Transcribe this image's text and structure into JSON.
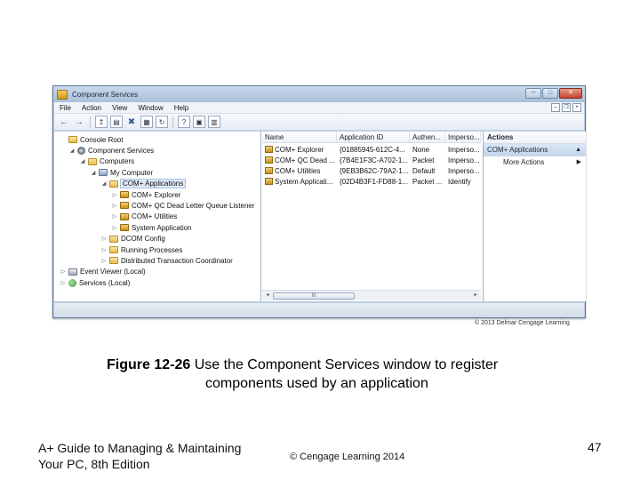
{
  "window": {
    "title": "Component Services",
    "controls": {
      "minimize": "─",
      "maximize": "□",
      "close": "✕"
    }
  },
  "menubar": {
    "items": [
      "File",
      "Action",
      "View",
      "Window",
      "Help"
    ],
    "mdi_controls": {
      "minimize": "–",
      "restore": "❐",
      "close": "×"
    }
  },
  "toolbar": {
    "back_icon": "←",
    "forward_icon": "→",
    "up_icon": "↥",
    "show_tree_icon": "▤",
    "delete_icon": "✖",
    "properties_icon": "▦",
    "refresh_icon": "↻",
    "help_icon": "?",
    "view_icon": "▣",
    "detail_icon": "▥"
  },
  "tree": {
    "items": [
      {
        "label": "Console Root",
        "toggle": "",
        "icon": "folder"
      },
      {
        "label": "Component Services",
        "toggle": "◢",
        "icon": "gear"
      },
      {
        "label": "Computers",
        "toggle": "◢",
        "icon": "folder"
      },
      {
        "label": "My Computer",
        "toggle": "◢",
        "icon": "computer"
      },
      {
        "label": "COM+ Applications",
        "toggle": "◢",
        "icon": "folder"
      },
      {
        "label": "COM+ Explorer",
        "toggle": "▷",
        "icon": "box"
      },
      {
        "label": "COM+ QC Dead Letter Queue Listener",
        "toggle": "▷",
        "icon": "box"
      },
      {
        "label": "COM+ Utilities",
        "toggle": "▷",
        "icon": "box"
      },
      {
        "label": "System Application",
        "toggle": "▷",
        "icon": "box"
      },
      {
        "label": "DCOM Config",
        "toggle": "▷",
        "icon": "folder"
      },
      {
        "label": "Running Processes",
        "toggle": "▷",
        "icon": "folder"
      },
      {
        "label": "Distributed Transaction Coordinator",
        "toggle": "▷",
        "icon": "folder"
      },
      {
        "label": "Event Viewer (Local)",
        "toggle": "▷",
        "icon": "viewer"
      },
      {
        "label": "Services (Local)",
        "toggle": "▷",
        "icon": "globe"
      }
    ]
  },
  "list": {
    "columns": [
      "Name",
      "Application ID",
      "Authen...",
      "Imperso..."
    ],
    "rows": [
      [
        "COM+ Explorer",
        "{01885945-612C-4...",
        "None",
        "Imperso..."
      ],
      [
        "COM+ QC Dead ...",
        "{7B4E1F3C-A702-1...",
        "Packet",
        "Imperso..."
      ],
      [
        "COM+ Utilities",
        "{9EB3B62C-79A2-1...",
        "Default",
        "Imperso..."
      ],
      [
        "System Applicati...",
        "{02D4B3F1-FD88-1...",
        "Packet ...",
        "Identify"
      ]
    ],
    "scroll": {
      "left": "◂",
      "right": "▸",
      "grip": "III"
    }
  },
  "actions": {
    "header": "Actions",
    "section": "COM+ Applications",
    "section_caret": "▲",
    "more": "More Actions",
    "more_caret": "▶"
  },
  "credit": "© 2013 Delmar Cengage Learning",
  "caption": {
    "label": "Figure 12-26",
    "line1": " Use the Component Services window to register",
    "line2": "components used by an application"
  },
  "footer": {
    "left_line1": "A+ Guide to Managing & Maintaining",
    "left_line2": "Your PC, 8th Edition",
    "center": "© Cengage Learning  2014",
    "page": "47"
  }
}
